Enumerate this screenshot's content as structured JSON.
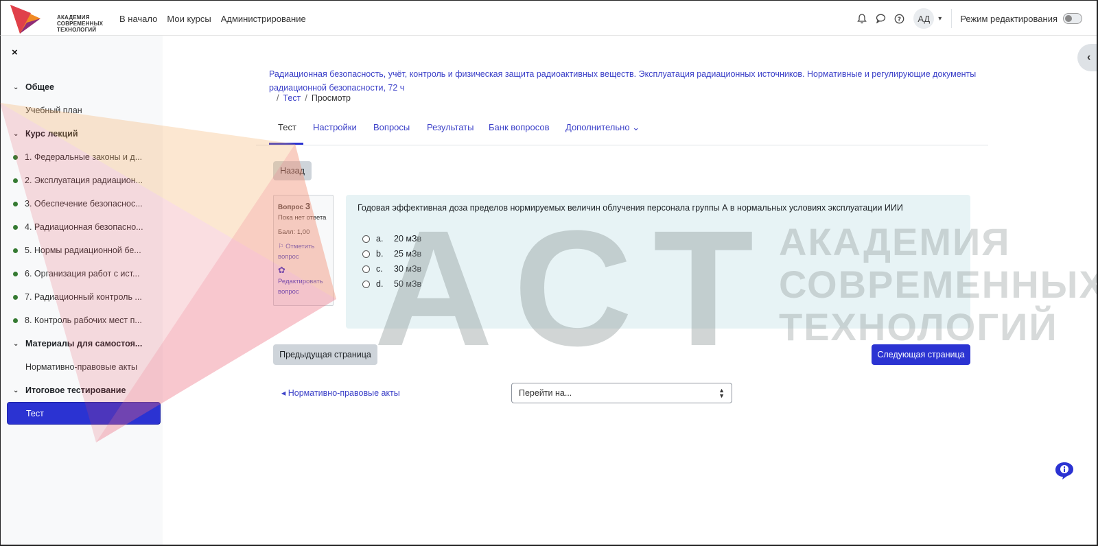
{
  "header": {
    "logo_lines": [
      "АКАДЕМИЯ",
      "СОВРЕМЕННЫХ",
      "ТЕХНОЛОГИЙ"
    ],
    "nav": [
      "В начало",
      "Мои курсы",
      "Администрирование"
    ],
    "avatar_initials": "АД",
    "edit_mode_label": "Режим редактирования",
    "icons": [
      "bell-icon",
      "chat-icon",
      "help-icon",
      "chevron-down-icon"
    ]
  },
  "sidebar": {
    "close_icon": "×",
    "items": [
      {
        "type": "section",
        "label": "Общее"
      },
      {
        "type": "item",
        "label": "Учебный план"
      },
      {
        "type": "section",
        "label": "Курс лекций"
      },
      {
        "type": "activity",
        "label": "1. Федеральные законы и д..."
      },
      {
        "type": "activity",
        "label": "2. Эксплуатация радиацион..."
      },
      {
        "type": "activity",
        "label": "3. Обеспечение безопаснос..."
      },
      {
        "type": "activity",
        "label": "4. Радиационная безопасно..."
      },
      {
        "type": "activity",
        "label": "5. Нормы радиационной бе..."
      },
      {
        "type": "activity",
        "label": "6. Организация работ с ист..."
      },
      {
        "type": "activity",
        "label": "7. Радиационный контроль ..."
      },
      {
        "type": "activity",
        "label": "8. Контроль рабочих мест п..."
      },
      {
        "type": "section",
        "label": "Материалы для самостоя..."
      },
      {
        "type": "item",
        "label": "Нормативно-правовые акты"
      },
      {
        "type": "section",
        "label": "Итоговое тестирование"
      },
      {
        "type": "active",
        "label": "Тест"
      }
    ],
    "completion_color": "#357a32"
  },
  "main": {
    "course_title": "Радиационная безопасность, учёт, контроль и физическая защита радиоактивных веществ. Эксплуатация радиационных источников. Нормативные и регулирующие документы радиационной безопасности, 72 ч",
    "breadcrumb": {
      "sep": "/",
      "link": "Тест",
      "current": "Просмотр"
    },
    "tabs": [
      "Тест",
      "Настройки",
      "Вопросы",
      "Результаты",
      "Банк вопросов",
      "Дополнительно"
    ],
    "more_caret": "⌄",
    "back_button": "Назад",
    "question_info": {
      "label": "Вопрос",
      "number": "3",
      "status": "Пока нет ответа",
      "mark": "Балл: 1,00",
      "flag_label": "Отметить вопрос",
      "edit_label": "Редактировать вопрос"
    },
    "question": {
      "text": "Годовая эффективная доза пределов нормируемых величин облучения персонала группы А в нормальных условиях эксплуатации ИИИ",
      "answers": [
        {
          "letter": "a.",
          "text": "20 мЗв"
        },
        {
          "letter": "b.",
          "text": "25 мЗв"
        },
        {
          "letter": "c.",
          "text": "30 мЗв"
        },
        {
          "letter": "d.",
          "text": "50 мЗв"
        }
      ]
    },
    "prev_page_button": "Предыдущая страница",
    "next_page_button": "Следующая страница",
    "prev_activity_link": "◂ Нормативно-правовые акты",
    "jump_to_placeholder": "Перейти на..."
  },
  "watermark": {
    "big": "АСТ",
    "lines": [
      "АКАДЕМИЯ",
      "СОВРЕМЕННЫХ",
      "ТЕХНОЛОГИЙ"
    ]
  },
  "colors": {
    "primary": "#2b33d2",
    "link": "#3b40c8",
    "question_bg": "#e7f3f5",
    "sidebar_bg": "#f8f9fa"
  }
}
